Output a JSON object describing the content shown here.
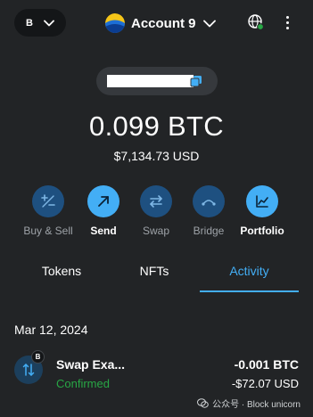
{
  "header": {
    "network_label": "B",
    "account_name": "Account 9"
  },
  "address": {
    "masked": true
  },
  "balance": {
    "crypto": "0.099 BTC",
    "fiat": "$7,134.73 USD"
  },
  "actions": [
    {
      "label": "Buy & Sell",
      "icon": "buy-sell-icon",
      "state": "disabled"
    },
    {
      "label": "Send",
      "icon": "send-arrow-icon",
      "state": "enabled"
    },
    {
      "label": "Swap",
      "icon": "swap-icon",
      "state": "disabled"
    },
    {
      "label": "Bridge",
      "icon": "bridge-icon",
      "state": "disabled"
    },
    {
      "label": "Portfolio",
      "icon": "portfolio-chart-icon",
      "state": "enabled"
    }
  ],
  "tabs": [
    {
      "label": "Tokens",
      "active": false
    },
    {
      "label": "NFTs",
      "active": false
    },
    {
      "label": "Activity",
      "active": true
    }
  ],
  "activity": {
    "date": "Mar 12, 2024",
    "transactions": [
      {
        "badge": "B",
        "title": "Swap Exa...",
        "status": "Confirmed",
        "amount": "-0.001 BTC",
        "fiat": "-$72.07 USD"
      }
    ]
  },
  "watermark": {
    "text": "公众号 · Block unicorn"
  },
  "colors": {
    "background": "#222426",
    "accent": "#43aef5",
    "muted_action": "#1e5080",
    "success": "#28a745"
  }
}
